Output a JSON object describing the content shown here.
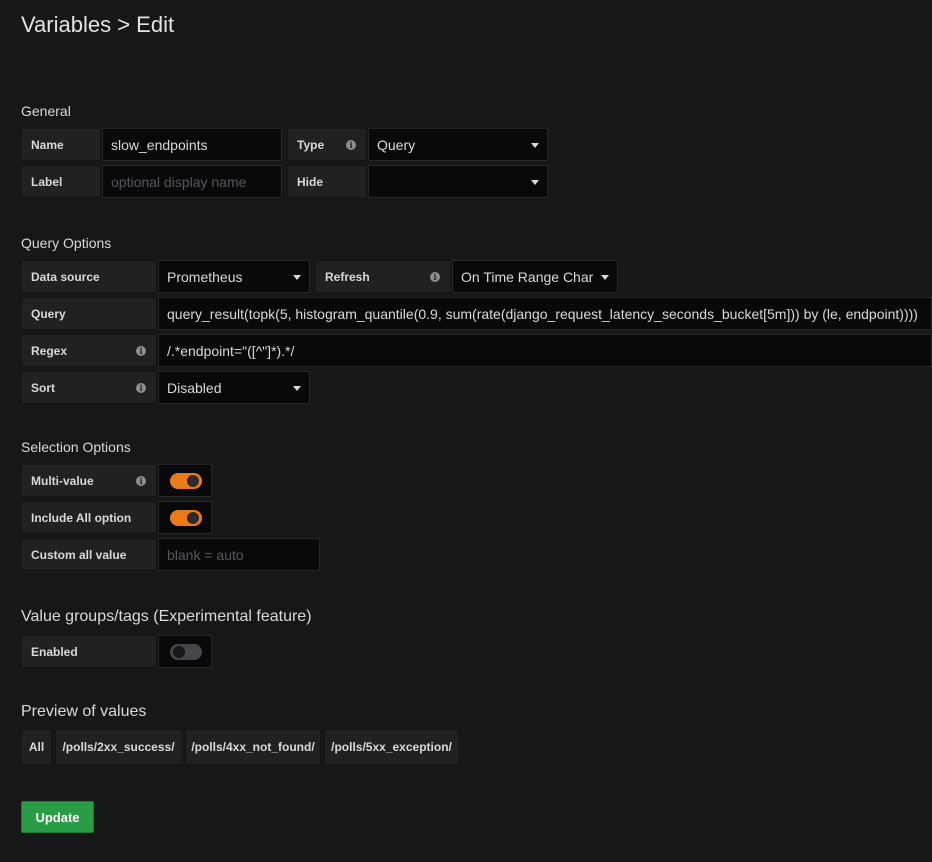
{
  "page": {
    "title": "Variables > Edit"
  },
  "general": {
    "section_title": "General",
    "name_label": "Name",
    "name_value": "slow_endpoints",
    "type_label": "Type",
    "type_value": "Query",
    "label_label": "Label",
    "label_placeholder": "optional display name",
    "hide_label": "Hide",
    "hide_value": ""
  },
  "query_options": {
    "section_title": "Query Options",
    "datasource_label": "Data source",
    "datasource_value": "Prometheus",
    "refresh_label": "Refresh",
    "refresh_value": "On Time Range Char",
    "query_label": "Query",
    "query_value": "query_result(topk(5, histogram_quantile(0.9, sum(rate(django_request_latency_seconds_bucket[5m])) by (le, endpoint))))",
    "regex_label": "Regex",
    "regex_value": "/.*endpoint=\"([^\"]*).*/",
    "sort_label": "Sort",
    "sort_value": "Disabled"
  },
  "selection_options": {
    "section_title": "Selection Options",
    "multi_value_label": "Multi-value",
    "multi_value_on": true,
    "include_all_label": "Include All option",
    "include_all_on": true,
    "custom_all_label": "Custom all value",
    "custom_all_placeholder": "blank = auto"
  },
  "value_groups": {
    "section_title": "Value groups/tags (Experimental feature)",
    "enabled_label": "Enabled",
    "enabled_on": false
  },
  "preview": {
    "section_title": "Preview of values",
    "values": [
      "All",
      "/polls/2xx_success/",
      "/polls/4xx_not_found/",
      "/polls/5xx_exception/"
    ]
  },
  "actions": {
    "update_label": "Update"
  },
  "colors": {
    "background": "#161719",
    "label_bg": "#212124",
    "input_bg": "#09090b",
    "toggle_on": "#eb7b18",
    "update_button": "#299c46"
  }
}
